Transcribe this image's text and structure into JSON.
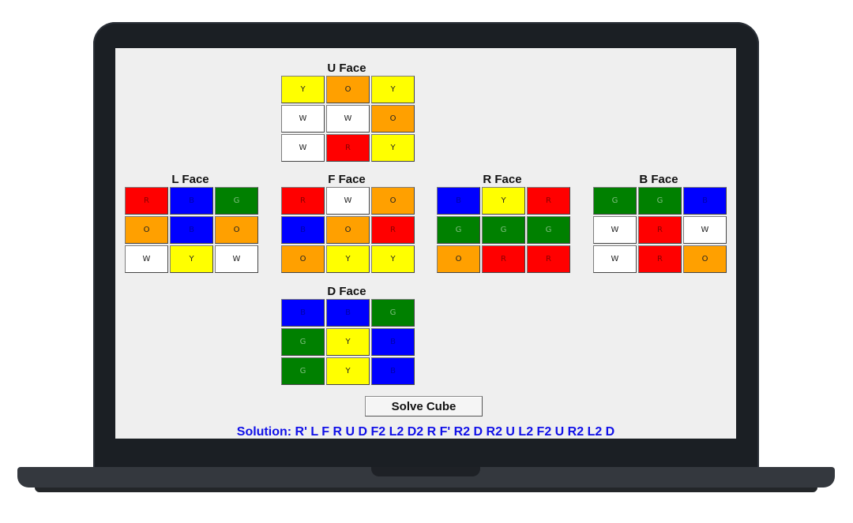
{
  "faces": {
    "U": {
      "label": "U Face",
      "stickers": [
        "Y",
        "O",
        "Y",
        "W",
        "W",
        "O",
        "W",
        "R",
        "Y"
      ]
    },
    "L": {
      "label": "L Face",
      "stickers": [
        "R",
        "B",
        "G",
        "O",
        "B",
        "O",
        "W",
        "Y",
        "W"
      ]
    },
    "F": {
      "label": "F Face",
      "stickers": [
        "R",
        "W",
        "O",
        "B",
        "O",
        "R",
        "O",
        "Y",
        "Y"
      ]
    },
    "R": {
      "label": "R Face",
      "stickers": [
        "B",
        "Y",
        "R",
        "G",
        "G",
        "G",
        "O",
        "R",
        "R"
      ]
    },
    "B": {
      "label": "B Face",
      "stickers": [
        "G",
        "G",
        "B",
        "W",
        "R",
        "W",
        "W",
        "R",
        "O"
      ]
    },
    "D": {
      "label": "D Face",
      "stickers": [
        "B",
        "B",
        "G",
        "G",
        "Y",
        "B",
        "G",
        "Y",
        "B"
      ]
    }
  },
  "solve_button": {
    "label": "Solve Cube"
  },
  "solution": {
    "text": "Solution: R' L F R U D F2 L2 D2 R F' R2 D R2 U L2 F2 U R2 L2 D"
  },
  "colors": {
    "Y": "#ffff00",
    "O": "#ffa000",
    "W": "#ffffff",
    "R": "#ff0000",
    "B": "#0000ff",
    "G": "#008000",
    "solution_text": "#1010e8"
  }
}
